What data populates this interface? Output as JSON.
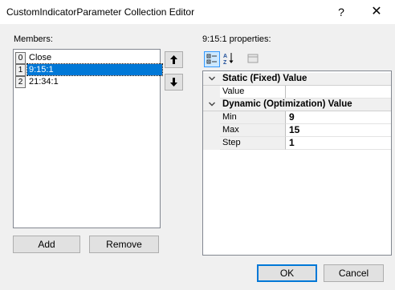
{
  "window": {
    "title": "CustomIndicatorParameter Collection Editor",
    "help_glyph": "?",
    "close_glyph": "✕"
  },
  "members": {
    "label": "Members:",
    "items": [
      {
        "index": "0",
        "name": "Close"
      },
      {
        "index": "1",
        "name": "9:15:1"
      },
      {
        "index": "2",
        "name": "21:34:1"
      }
    ],
    "selected_index": 1
  },
  "buttons": {
    "add": "Add",
    "remove": "Remove",
    "ok": "OK",
    "cancel": "Cancel"
  },
  "properties": {
    "label": "9:15:1 properties:",
    "categories": [
      {
        "name": "Static (Fixed) Value",
        "rows": [
          {
            "name": "Value",
            "value": ""
          }
        ]
      },
      {
        "name": "Dynamic (Optimization) Value",
        "rows": [
          {
            "name": "Min",
            "value": "9"
          },
          {
            "name": "Max",
            "value": "15"
          },
          {
            "name": "Step",
            "value": "1"
          }
        ]
      }
    ]
  },
  "toolbar": {
    "icons": [
      "categorized-icon",
      "alphabetical-icon",
      "property-pages-icon"
    ],
    "alpha_glyph": "A↓Z"
  },
  "colors": {
    "selection": "#0078d7",
    "accent_border": "#0078d7"
  }
}
